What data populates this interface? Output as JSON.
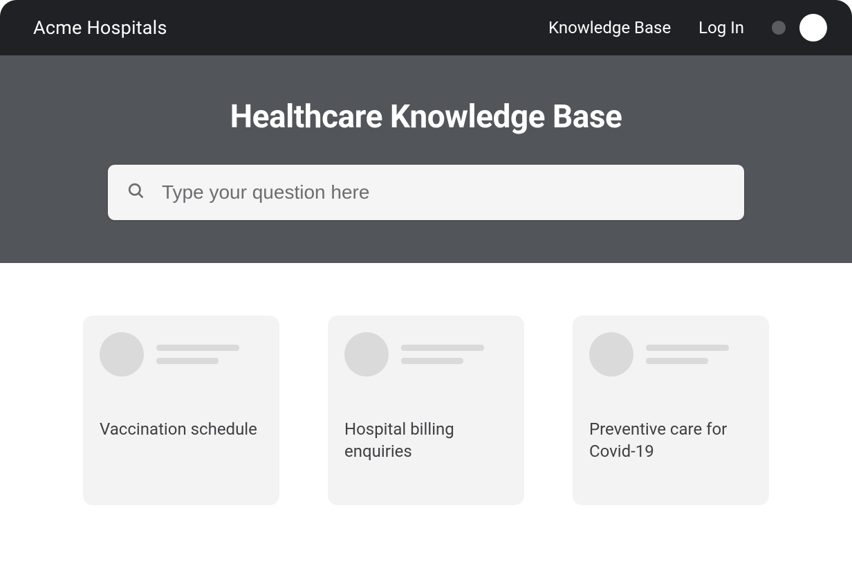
{
  "header": {
    "brand": "Acme Hospitals",
    "nav": {
      "knowledge_base": "Knowledge Base",
      "log_in": "Log In"
    }
  },
  "hero": {
    "title": "Healthcare Knowledge Base",
    "search_placeholder": "Type your question here"
  },
  "cards": [
    {
      "title": "Vaccination schedule"
    },
    {
      "title": "Hospital billing enquiries"
    },
    {
      "title": "Preventive care for Covid-19"
    }
  ]
}
